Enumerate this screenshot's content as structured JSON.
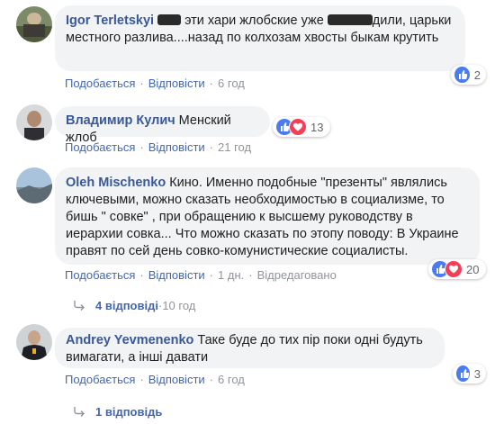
{
  "colors": {
    "link": "#4267b2",
    "author": "#385898",
    "bubble": "#f2f3f5",
    "meta": "#90949c"
  },
  "comments": [
    {
      "author": "Igor Terletskyi",
      "text_a": " эти хари жлобские уже ",
      "text_b": "дили, царьки местного разлива....назад по колхозам хвосты быкам крутить",
      "actions": {
        "like": "Подобається",
        "reply": "Відповісти",
        "time": "6 год"
      },
      "reactions": {
        "icons": [
          "like-icon"
        ],
        "count": "2"
      }
    },
    {
      "author": "Владимир Кулич",
      "text": "Менский жлоб",
      "actions": {
        "like": "Подобається",
        "reply": "Відповісти",
        "time": "21 год"
      },
      "reactions": {
        "icons": [
          "like-icon",
          "love-icon"
        ],
        "count": "13"
      }
    },
    {
      "author": "Oleh Mischenko",
      "text": "Кино. Именно подобные \"презенты\" являлись ключевыми, можно сказать необходимостью в социализме, то бишь \" совке\" , при обращению к высшему руководству в иерархии совка... Что можно сказать по этопу поводу: В Украине правят по сей день совко-комунистические социалисты.",
      "actions": {
        "like": "Подобається",
        "reply": "Відповісти",
        "time": "1 дн.",
        "edited": "Відредаговано"
      },
      "reactions": {
        "icons": [
          "like-icon",
          "love-icon"
        ],
        "count": "20"
      },
      "replies": {
        "label": "4 відповіді",
        "time": "10 год"
      }
    },
    {
      "author": "Andrey Yevmenenko",
      "text": "Таке буде до тих пір поки одні будуть вимагати, а інші давати",
      "actions": {
        "like": "Подобається",
        "reply": "Відповісти",
        "time": "6 год"
      },
      "reactions": {
        "icons": [
          "like-icon"
        ],
        "count": "3"
      },
      "replies": {
        "label": "1 відповідь"
      }
    }
  ]
}
